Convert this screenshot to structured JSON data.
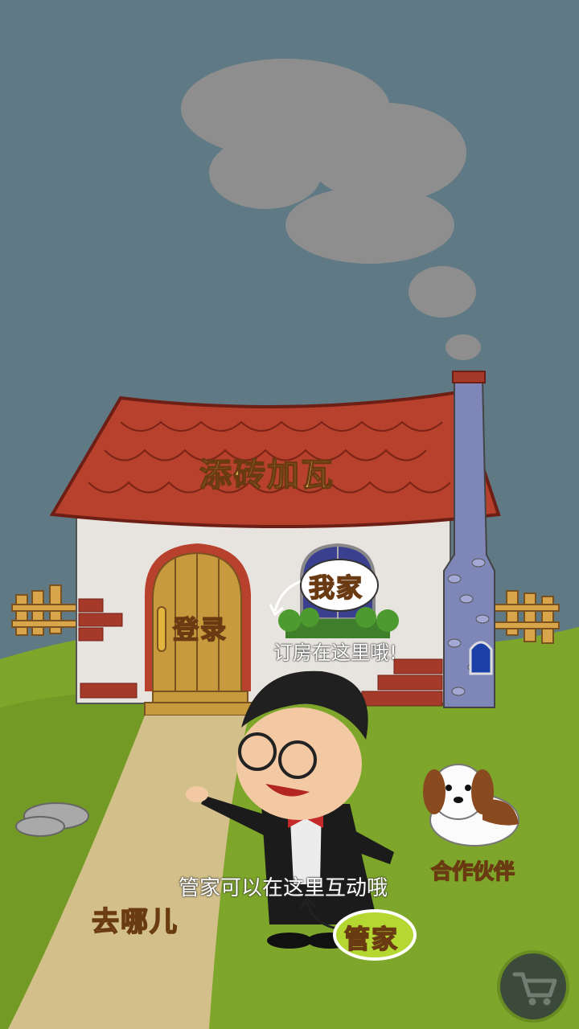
{
  "roof_sign": "添砖加瓦",
  "login_label": "登录",
  "myhome_label": "我家",
  "myhome_hint": "订房在这里哦!",
  "butler_label": "管家",
  "butler_hint": "管家可以在这里互动哦",
  "goto_label": "去哪儿",
  "partner_label": "合作伙伴",
  "icons": [
    "cart-icon"
  ],
  "colors": {
    "sky": "#5f7a85",
    "grass": "#7da62a",
    "roof": "#b7412c",
    "label_fill": "#e9c25b",
    "label_stroke": "#6a3a12"
  }
}
